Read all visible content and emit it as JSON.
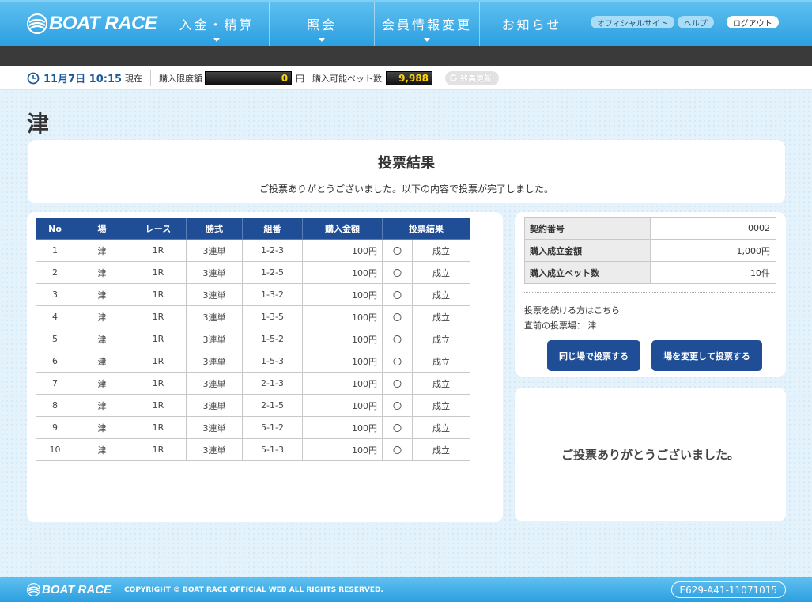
{
  "header": {
    "logo_text": "BOAT RACE",
    "nav": [
      {
        "label": "入金・精算",
        "has_dropdown": true
      },
      {
        "label": "照会",
        "has_dropdown": true
      },
      {
        "label": "会員情報変更",
        "has_dropdown": true
      },
      {
        "label": "お知らせ",
        "has_dropdown": false
      }
    ],
    "official_site": "オフィシャルサイト",
    "help": "ヘルプ",
    "logout": "ログアウト"
  },
  "status": {
    "datetime": "11月7日 10:15",
    "datetime_suffix": "現在",
    "purchase_limit_label": "購入限度額",
    "purchase_limit_value": "0",
    "purchase_limit_unit": "円",
    "bet_count_label": "購入可能ベット数",
    "bet_count_value": "9,988",
    "refresh_label": "残高更新"
  },
  "page": {
    "venue": "津",
    "result_title": "投票結果",
    "result_message": "ご投票ありがとうございました。以下の内容で投票が完了しました。",
    "thanks_message": "ご投票ありがとうございました。"
  },
  "results_table": {
    "headers": [
      "No",
      "場",
      "レース",
      "勝式",
      "組番",
      "購入金額",
      "投票結果"
    ],
    "rows": [
      {
        "no": "1",
        "venue": "津",
        "race": "1R",
        "type": "3連単",
        "combo": "1-2-3",
        "amount": "100円",
        "mark": "〇",
        "result": "成立"
      },
      {
        "no": "2",
        "venue": "津",
        "race": "1R",
        "type": "3連単",
        "combo": "1-2-5",
        "amount": "100円",
        "mark": "〇",
        "result": "成立"
      },
      {
        "no": "3",
        "venue": "津",
        "race": "1R",
        "type": "3連単",
        "combo": "1-3-2",
        "amount": "100円",
        "mark": "〇",
        "result": "成立"
      },
      {
        "no": "4",
        "venue": "津",
        "race": "1R",
        "type": "3連単",
        "combo": "1-3-5",
        "amount": "100円",
        "mark": "〇",
        "result": "成立"
      },
      {
        "no": "5",
        "venue": "津",
        "race": "1R",
        "type": "3連単",
        "combo": "1-5-2",
        "amount": "100円",
        "mark": "〇",
        "result": "成立"
      },
      {
        "no": "6",
        "venue": "津",
        "race": "1R",
        "type": "3連単",
        "combo": "1-5-3",
        "amount": "100円",
        "mark": "〇",
        "result": "成立"
      },
      {
        "no": "7",
        "venue": "津",
        "race": "1R",
        "type": "3連単",
        "combo": "2-1-3",
        "amount": "100円",
        "mark": "〇",
        "result": "成立"
      },
      {
        "no": "8",
        "venue": "津",
        "race": "1R",
        "type": "3連単",
        "combo": "2-1-5",
        "amount": "100円",
        "mark": "〇",
        "result": "成立"
      },
      {
        "no": "9",
        "venue": "津",
        "race": "1R",
        "type": "3連単",
        "combo": "5-1-2",
        "amount": "100円",
        "mark": "〇",
        "result": "成立"
      },
      {
        "no": "10",
        "venue": "津",
        "race": "1R",
        "type": "3連単",
        "combo": "5-1-3",
        "amount": "100円",
        "mark": "〇",
        "result": "成立"
      }
    ]
  },
  "contract": {
    "rows": [
      {
        "label": "契約番号",
        "value": "0002"
      },
      {
        "label": "購入成立金額",
        "value": "1,000円"
      },
      {
        "label": "購入成立ベット数",
        "value": "10件"
      }
    ],
    "continue_text": "投票を続ける方はこちら",
    "last_venue_label": "直前の投票場：",
    "last_venue": "津",
    "same_venue_button": "同じ場で投票する",
    "change_venue_button": "場を変更して投票する"
  },
  "footer": {
    "logo_text": "BOAT RACE",
    "copyright": "COPYRIGHT © BOAT RACE OFFICIAL WEB ALL RIGHTS RESERVED.",
    "terminal_id": "E629-A41-11071015"
  }
}
